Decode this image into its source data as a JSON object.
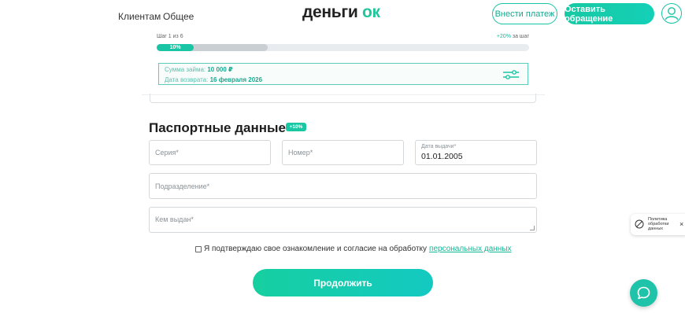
{
  "header": {
    "nav": [
      "Клиентам",
      "Общее"
    ],
    "logo_main": "деньги ",
    "logo_accent": "ок",
    "pay_button": "Внести платеж",
    "request_button": "Оставить обращение",
    "profile_icon": "user-icon"
  },
  "progress": {
    "step_label": "Шаг 1 из 6",
    "bonus_value": "+20%",
    "bonus_suffix": " за шаг",
    "percent_label": "10%",
    "percent": 10
  },
  "summary": {
    "amount_label": "Сумма займа:",
    "amount_value": "10 000 ₽",
    "date_label": "Дата возврата:",
    "date_value": "16 февраля 2026",
    "settings_icon": "sliders-icon"
  },
  "passport": {
    "title": "Паспортные данные",
    "badge": "+10%",
    "series_placeholder": "Серия*",
    "number_placeholder": "Номер*",
    "issue_date_label": "Дата выдачи*",
    "issue_date_value": "01.01.2005",
    "division_placeholder": "Подразделение*",
    "issued_by_placeholder": "Кем выдан*"
  },
  "consent": {
    "text": "Я подтверждаю свое ознакомление и согласие на обработку",
    "link": "персональных данных",
    "checked": false
  },
  "continue_button": "Продолжить",
  "policy_popup": {
    "text": "Политика обработки данных",
    "close": "×"
  },
  "chat_icon": "chat-bubble-icon",
  "colors": {
    "accent": "#19c5a5",
    "accent_dark": "#13a88e"
  }
}
